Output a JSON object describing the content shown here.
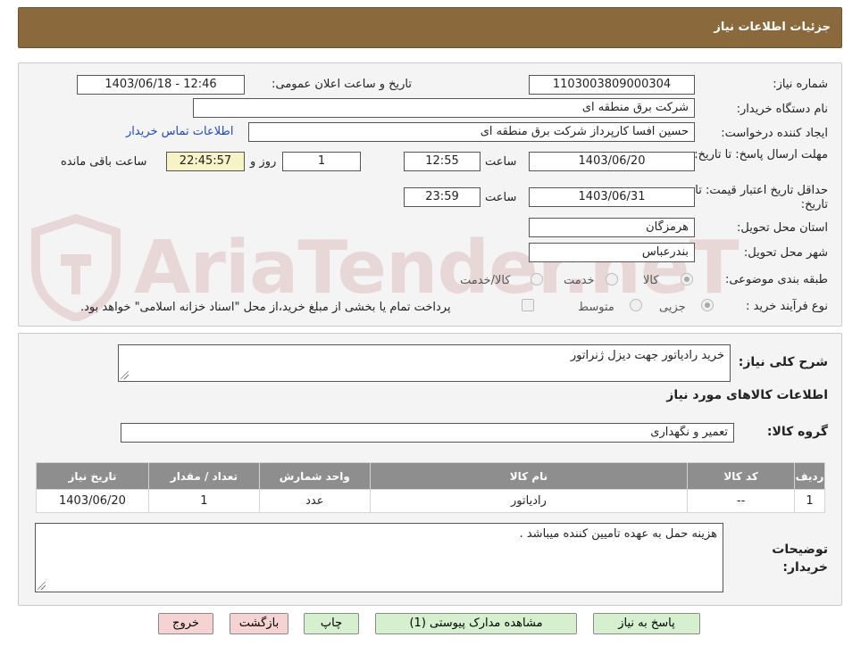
{
  "header": {
    "title": "جزئیات اطلاعات نیاز"
  },
  "info": {
    "need_number_label": "شماره نیاز:",
    "need_number": "1103003809000304",
    "announce_label": "تاریخ و ساعت اعلان عمومی:",
    "announce_value": "1403/06/18 - 12:46",
    "buyer_org_label": "نام دستگاه خریدار:",
    "buyer_org": "شرکت برق منطقه ای",
    "creator_label": "ایجاد کننده درخواست:",
    "creator": "حسین افسا کارپرداز شرکت برق منطقه ای",
    "contact_link": "اطلاعات تماس خریدار",
    "reply_deadline_label": "مهلت ارسال پاسخ: تا تاریخ:",
    "reply_date": "1403/06/20",
    "time_label": "ساعت",
    "reply_time": "12:55",
    "days_value": "1",
    "days_label": "روز و",
    "remaining_time": "22:45:57",
    "remaining_label": "ساعت باقی مانده",
    "validity_label": "حداقل تاریخ اعتبار قیمت: تا تاریخ:",
    "validity_date": "1403/06/31",
    "validity_time": "23:59",
    "province_label": "استان محل تحویل:",
    "province": "هرمزگان",
    "city_label": "شهر محل تحویل:",
    "city": "بندرعباس",
    "category_label": "طبقه بندی موضوعی:",
    "category_options": [
      "کالا",
      "خدمت",
      "کالا/خدمت"
    ],
    "process_label": "نوع فرآیند خرید :",
    "process_options": [
      "جزیی",
      "متوسط"
    ],
    "payment_note": "پرداخت تمام یا بخشی از مبلغ خرید،از محل \"اسناد خزانه اسلامی\" خواهد بود."
  },
  "detail": {
    "summary_label": "شرح کلی نیاز:",
    "summary": "خرید رادیاتور جهت دیزل ژنراتور",
    "items_heading": "اطلاعات کالاهای مورد نیاز",
    "group_label": "گروه کالا:",
    "group_value": "تعمیر و نگهداری",
    "table": {
      "headers": [
        "ردیف",
        "کد کالا",
        "نام کالا",
        "واحد شمارش",
        "تعداد / مقدار",
        "تاریخ نیاز"
      ],
      "rows": [
        [
          "1",
          "--",
          "رادیاتور",
          "عدد",
          "1",
          "1403/06/20"
        ]
      ]
    },
    "buyer_notes_label": "توضیحات خریدار:",
    "buyer_notes": "هزینه حمل به عهده تامیین کننده میباشد ."
  },
  "buttons": {
    "reply": "پاسخ به نیاز",
    "attachments": "مشاهده مدارک پیوستی (1)",
    "print": "چاپ",
    "back": "بازگشت",
    "exit": "خروج"
  },
  "watermark": {
    "text": "AriaTender.neT"
  },
  "colors": {
    "header_bg": "#8a6a3c",
    "table_header_bg": "#8e8e8e",
    "button_green": "#d6f0cf",
    "button_pink": "#f6d3d3",
    "link": "#2147c4"
  }
}
